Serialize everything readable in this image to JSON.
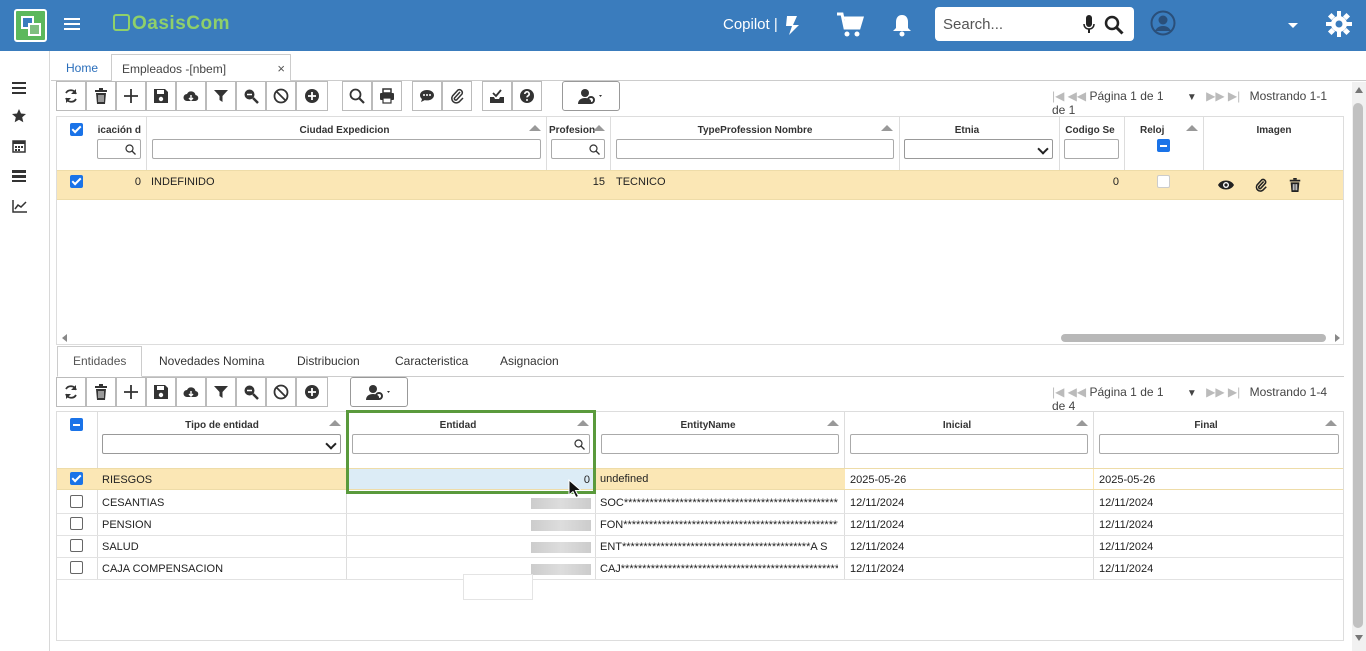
{
  "header": {
    "brand": "OasisCom",
    "copilot_label": "Copilot |",
    "search_placeholder": "Search..."
  },
  "tabs": {
    "home": "Home",
    "active": "Empleados -[nbem]",
    "close": "×"
  },
  "pager_top": {
    "page": "Página 1 de 1",
    "showing": "Mostrando 1-1 de 1"
  },
  "pager_bottom": {
    "page": "Página 1 de 1",
    "showing": "Mostrando 1-4 de 4"
  },
  "top_grid": {
    "columns": {
      "c1": "icación d",
      "c2": "Ciudad Expedicion",
      "c3": "Profesion",
      "c4": "TypeProfession Nombre",
      "c5": "Etnia",
      "c6": "Codigo Se",
      "c7": "Reloj",
      "c8": "Imagen"
    },
    "row": {
      "c1": "0",
      "c2": "INDEFINIDO",
      "c3": "15",
      "c4": "TECNICO",
      "c6": "0"
    }
  },
  "subtabs": [
    "Entidades",
    "Novedades Nomina",
    "Distribucion",
    "Caracteristica",
    "Asignacion"
  ],
  "bottom_grid": {
    "columns": {
      "tipo": "Tipo de entidad",
      "entidad": "Entidad",
      "name": "EntityName",
      "inicial": "Inicial",
      "final": "Final"
    },
    "rows": [
      {
        "tipo": "RIESGOS",
        "entidad": "0",
        "name": "undefined",
        "inicial": "2025-05-26",
        "final": "2025-05-26"
      },
      {
        "tipo": "CESANTIAS",
        "entidad": "",
        "name": "SOC*****************************************************",
        "inicial": "12/11/2024",
        "final": "12/11/2024"
      },
      {
        "tipo": "PENSION",
        "entidad": "",
        "name": "FON*****************************************************",
        "inicial": "12/11/2024",
        "final": "12/11/2024"
      },
      {
        "tipo": "SALUD",
        "entidad": "",
        "name": "ENT********************************************A S",
        "inicial": "12/11/2024",
        "final": "12/11/2024"
      },
      {
        "tipo": "CAJA COMPENSACION",
        "entidad": "",
        "name": "CAJ*****************************************************",
        "inicial": "12/11/2024",
        "final": "12/11/2024"
      }
    ]
  },
  "colors": {
    "header": "#3a7cbd",
    "selected_row": "#fbe7b5",
    "checkbox": "#1a73e8",
    "highlight": "#5a9a3c"
  }
}
